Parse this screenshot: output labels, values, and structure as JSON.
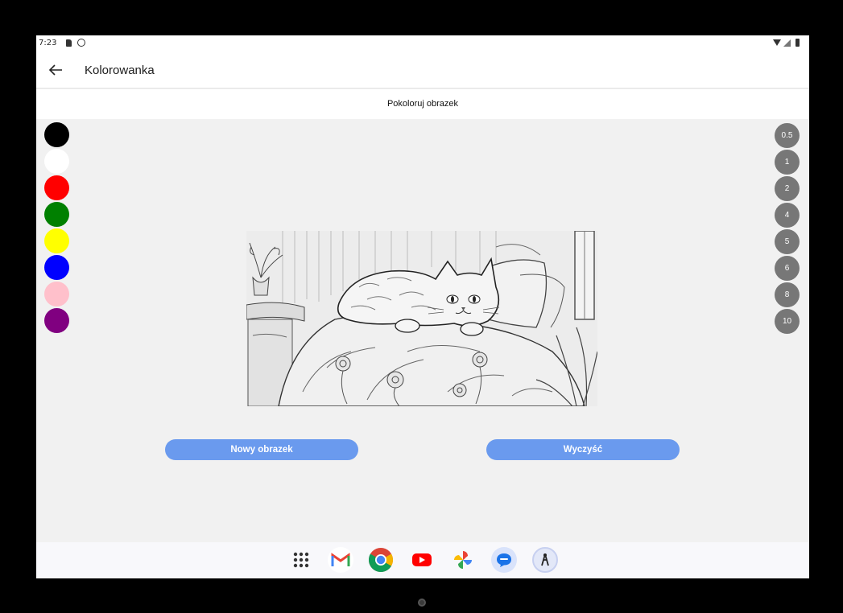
{
  "status_bar": {
    "time": "7:23"
  },
  "app_bar": {
    "title": "Kolorowanka"
  },
  "subheader": {
    "title": "Pokoloruj obrazek"
  },
  "palette": [
    {
      "name": "black",
      "color": "#000000"
    },
    {
      "name": "white",
      "color": "#ffffff"
    },
    {
      "name": "red",
      "color": "#ff0000"
    },
    {
      "name": "green",
      "color": "#008000"
    },
    {
      "name": "yellow",
      "color": "#ffff00"
    },
    {
      "name": "blue",
      "color": "#0000ff"
    },
    {
      "name": "pink",
      "color": "#ffc0cb"
    },
    {
      "name": "purple",
      "color": "#800080"
    }
  ],
  "brush_sizes": [
    "0.5",
    "1",
    "2",
    "4",
    "5",
    "6",
    "8",
    "10"
  ],
  "buttons": {
    "new_image": "Nowy obrazek",
    "clear": "Wyczyść"
  },
  "coloring_image": {
    "subject": "cat-on-bed-line-art"
  },
  "dock": [
    "apps-grid-icon",
    "gmail-icon",
    "chrome-icon",
    "youtube-icon",
    "photos-icon",
    "messages-icon",
    "app-icon"
  ],
  "colors": {
    "accent": "#6a9aee",
    "size_button": "#777777",
    "background": "#f1f1f1"
  }
}
